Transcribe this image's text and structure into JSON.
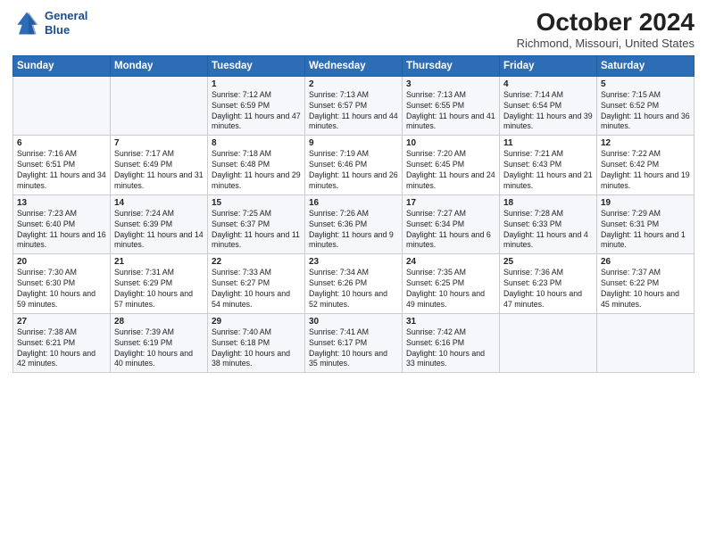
{
  "header": {
    "logo_line1": "General",
    "logo_line2": "Blue",
    "month_title": "October 2024",
    "location": "Richmond, Missouri, United States"
  },
  "days_of_week": [
    "Sunday",
    "Monday",
    "Tuesday",
    "Wednesday",
    "Thursday",
    "Friday",
    "Saturday"
  ],
  "weeks": [
    [
      {
        "day": "",
        "info": ""
      },
      {
        "day": "",
        "info": ""
      },
      {
        "day": "1",
        "info": "Sunrise: 7:12 AM\nSunset: 6:59 PM\nDaylight: 11 hours and 47 minutes."
      },
      {
        "day": "2",
        "info": "Sunrise: 7:13 AM\nSunset: 6:57 PM\nDaylight: 11 hours and 44 minutes."
      },
      {
        "day": "3",
        "info": "Sunrise: 7:13 AM\nSunset: 6:55 PM\nDaylight: 11 hours and 41 minutes."
      },
      {
        "day": "4",
        "info": "Sunrise: 7:14 AM\nSunset: 6:54 PM\nDaylight: 11 hours and 39 minutes."
      },
      {
        "day": "5",
        "info": "Sunrise: 7:15 AM\nSunset: 6:52 PM\nDaylight: 11 hours and 36 minutes."
      }
    ],
    [
      {
        "day": "6",
        "info": "Sunrise: 7:16 AM\nSunset: 6:51 PM\nDaylight: 11 hours and 34 minutes."
      },
      {
        "day": "7",
        "info": "Sunrise: 7:17 AM\nSunset: 6:49 PM\nDaylight: 11 hours and 31 minutes."
      },
      {
        "day": "8",
        "info": "Sunrise: 7:18 AM\nSunset: 6:48 PM\nDaylight: 11 hours and 29 minutes."
      },
      {
        "day": "9",
        "info": "Sunrise: 7:19 AM\nSunset: 6:46 PM\nDaylight: 11 hours and 26 minutes."
      },
      {
        "day": "10",
        "info": "Sunrise: 7:20 AM\nSunset: 6:45 PM\nDaylight: 11 hours and 24 minutes."
      },
      {
        "day": "11",
        "info": "Sunrise: 7:21 AM\nSunset: 6:43 PM\nDaylight: 11 hours and 21 minutes."
      },
      {
        "day": "12",
        "info": "Sunrise: 7:22 AM\nSunset: 6:42 PM\nDaylight: 11 hours and 19 minutes."
      }
    ],
    [
      {
        "day": "13",
        "info": "Sunrise: 7:23 AM\nSunset: 6:40 PM\nDaylight: 11 hours and 16 minutes."
      },
      {
        "day": "14",
        "info": "Sunrise: 7:24 AM\nSunset: 6:39 PM\nDaylight: 11 hours and 14 minutes."
      },
      {
        "day": "15",
        "info": "Sunrise: 7:25 AM\nSunset: 6:37 PM\nDaylight: 11 hours and 11 minutes."
      },
      {
        "day": "16",
        "info": "Sunrise: 7:26 AM\nSunset: 6:36 PM\nDaylight: 11 hours and 9 minutes."
      },
      {
        "day": "17",
        "info": "Sunrise: 7:27 AM\nSunset: 6:34 PM\nDaylight: 11 hours and 6 minutes."
      },
      {
        "day": "18",
        "info": "Sunrise: 7:28 AM\nSunset: 6:33 PM\nDaylight: 11 hours and 4 minutes."
      },
      {
        "day": "19",
        "info": "Sunrise: 7:29 AM\nSunset: 6:31 PM\nDaylight: 11 hours and 1 minute."
      }
    ],
    [
      {
        "day": "20",
        "info": "Sunrise: 7:30 AM\nSunset: 6:30 PM\nDaylight: 10 hours and 59 minutes."
      },
      {
        "day": "21",
        "info": "Sunrise: 7:31 AM\nSunset: 6:29 PM\nDaylight: 10 hours and 57 minutes."
      },
      {
        "day": "22",
        "info": "Sunrise: 7:33 AM\nSunset: 6:27 PM\nDaylight: 10 hours and 54 minutes."
      },
      {
        "day": "23",
        "info": "Sunrise: 7:34 AM\nSunset: 6:26 PM\nDaylight: 10 hours and 52 minutes."
      },
      {
        "day": "24",
        "info": "Sunrise: 7:35 AM\nSunset: 6:25 PM\nDaylight: 10 hours and 49 minutes."
      },
      {
        "day": "25",
        "info": "Sunrise: 7:36 AM\nSunset: 6:23 PM\nDaylight: 10 hours and 47 minutes."
      },
      {
        "day": "26",
        "info": "Sunrise: 7:37 AM\nSunset: 6:22 PM\nDaylight: 10 hours and 45 minutes."
      }
    ],
    [
      {
        "day": "27",
        "info": "Sunrise: 7:38 AM\nSunset: 6:21 PM\nDaylight: 10 hours and 42 minutes."
      },
      {
        "day": "28",
        "info": "Sunrise: 7:39 AM\nSunset: 6:19 PM\nDaylight: 10 hours and 40 minutes."
      },
      {
        "day": "29",
        "info": "Sunrise: 7:40 AM\nSunset: 6:18 PM\nDaylight: 10 hours and 38 minutes."
      },
      {
        "day": "30",
        "info": "Sunrise: 7:41 AM\nSunset: 6:17 PM\nDaylight: 10 hours and 35 minutes."
      },
      {
        "day": "31",
        "info": "Sunrise: 7:42 AM\nSunset: 6:16 PM\nDaylight: 10 hours and 33 minutes."
      },
      {
        "day": "",
        "info": ""
      },
      {
        "day": "",
        "info": ""
      }
    ]
  ]
}
